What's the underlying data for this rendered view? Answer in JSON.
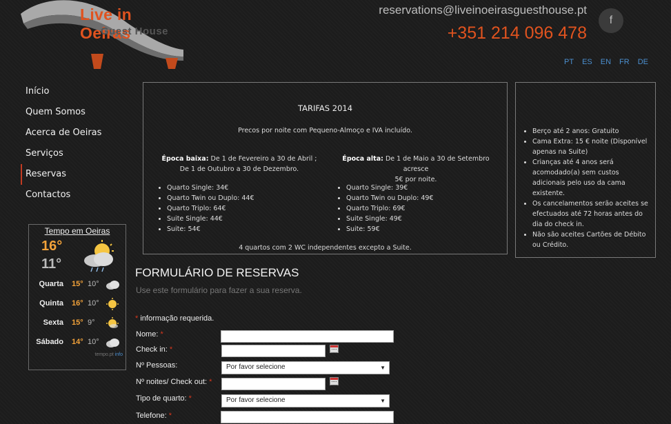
{
  "brand": {
    "title": "Live in Oeiras",
    "subtitle": "Guest House"
  },
  "contact": {
    "email": "reservations@liveinoeirasguesthouse.pt",
    "phone": "+351 214 096 478"
  },
  "social": {
    "facebook": "f"
  },
  "languages": [
    "PT",
    "ES",
    "EN",
    "FR",
    "DE"
  ],
  "nav": [
    "Início",
    "Quem Somos",
    "Acerca de Oeiras",
    "Serviços",
    "Reservas",
    "Contactos"
  ],
  "weather": {
    "title": "Tempo em Oeiras",
    "today_high": "16°",
    "today_low": "11°",
    "forecast": [
      {
        "day": "Quarta",
        "high": "15°",
        "low": "10°",
        "icon": "cloudy-icon"
      },
      {
        "day": "Quinta",
        "high": "16°",
        "low": "10°",
        "icon": "sun-icon"
      },
      {
        "day": "Sexta",
        "high": "15°",
        "low": "9°",
        "icon": "partly-sunny-icon"
      },
      {
        "day": "Sábado",
        "high": "14°",
        "low": "10°",
        "icon": "cloudy-icon"
      }
    ],
    "credit_text": "tempo.pt",
    "credit_link": "info"
  },
  "tarifas": {
    "heading": "TARIFAS 2014",
    "intro": "Precos por noite com Pequeno-Almoço e IVA incluído.",
    "low": {
      "label": "Época baixa:",
      "text1": " De 1 de Fevereiro a 30 de Abril ;",
      "text2": "De 1 de Outubro a 30 de Dezembro.",
      "items": [
        "Quarto Single: 34€",
        "Quarto Twin ou Duplo: 44€",
        "Quarto Triplo: 64€",
        "Suite Single: 44€",
        "Suite: 54€"
      ]
    },
    "high": {
      "label": "Época alta:",
      "text1": " De 1 de Maio a 30 de Setembro acresce",
      "text2": "5€ por noite.",
      "items": [
        "Quarto Single: 39€",
        "Quarto Twin ou Duplo: 49€",
        "Quarto Triplo: 69€",
        "Suite Single: 49€",
        "Suite: 59€"
      ]
    },
    "footer": "4 quartos com 2 WC independentes excepto a Suite."
  },
  "extras": [
    "Berço até 2 anos: Gratuito",
    "Cama Extra: 15 € noite (Disponível apenas na Suite)",
    "Crianças até 4 anos será acomodado(a) sem custos adicionais pelo uso da cama existente.",
    "Os cancelamentos serão aceites se efectuados até 72 horas antes do dia do check in.",
    "Não são aceites Cartões de Débito ou Crédito."
  ],
  "form": {
    "title": "FORMULÁRIO DE RESERVAS",
    "subtitle": "Use este formulário para fazer a sua reserva.",
    "required_note": " informação requerida.",
    "required_mark": "*",
    "name_label": "Nome:",
    "checkin_label": "Check in:",
    "persons_label": "Nº Pessoas:",
    "persons_value": "Por favor selecione",
    "nights_label": "Nº noites/ Check out:",
    "room_label": "Tipo de quarto:",
    "room_value": "Por favor selecione",
    "phone_label": "Telefone:"
  }
}
